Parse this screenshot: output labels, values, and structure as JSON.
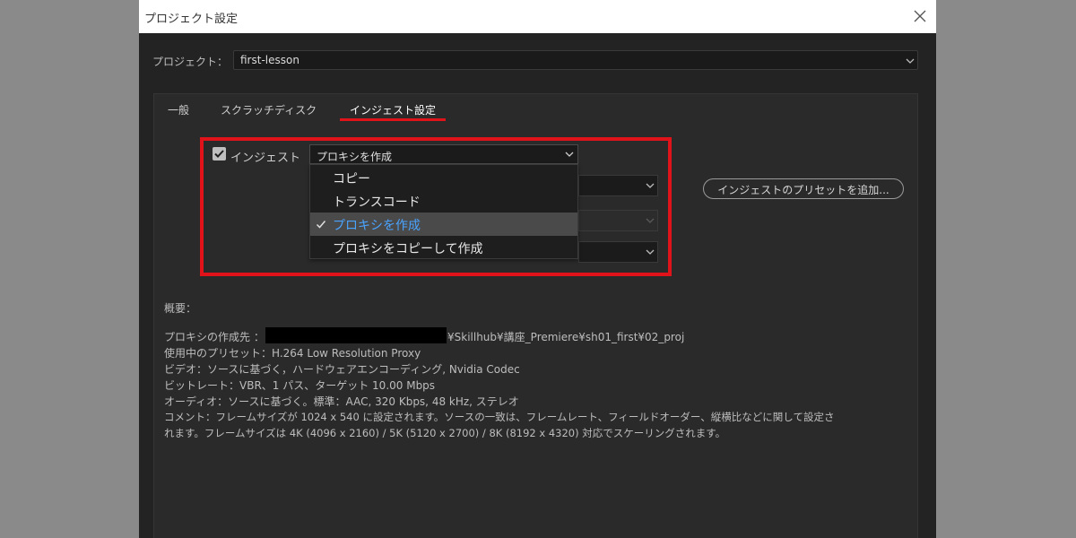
{
  "window": {
    "title": "プロジェクト設定"
  },
  "project": {
    "label": "プロジェクト：",
    "value": "first-lesson"
  },
  "tabs": [
    {
      "label": "一般"
    },
    {
      "label": "スクラッチディスク"
    },
    {
      "label": "インジェスト設定"
    }
  ],
  "ingest": {
    "label": "インジェスト",
    "checked": true,
    "selected": "プロキシを作成",
    "options": [
      {
        "label": "コピー"
      },
      {
        "label": "トランスコード"
      },
      {
        "label": "プロキシを作成"
      },
      {
        "label": "プロキシをコピーして作成"
      }
    ]
  },
  "preset_button": {
    "label": "インジェストのプリセットを追加..."
  },
  "summary": {
    "title": "概要：",
    "dest_label": "プロキシの作成先 ：",
    "dest_path": "¥Skillhub¥講座_Premiere¥sh01_first¥02_proj",
    "preset": "使用中のプリセット：H.264 Low Resolution Proxy",
    "video": "ビデオ：ソースに基づく，ハードウェアエンコーディング, Nvidia Codec",
    "bitrate": "ビットレート：VBR、1 パス、ターゲット 10.00 Mbps",
    "audio": "オーディオ：ソースに基づく。標準：AAC, 320 Kbps, 48 kHz, ステレオ",
    "comment1": "コメント：フレームサイズが 1024 x 540 に設定されます。ソースの一致は、フレームレート、フィールドオーダー、縦横比などに関して設定さ",
    "comment2": "れます。フレームサイズは 4K (4096 x 2160) / 5K (5120 x 2700) / 8K (8192 x 4320) 対応でスケーリングされます。"
  },
  "colors": {
    "highlight": "#e0121a",
    "selected_text": "#4aa3ff",
    "dialog_bg": "#232323"
  }
}
